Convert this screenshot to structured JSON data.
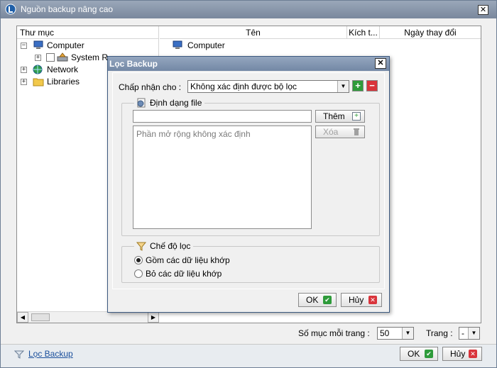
{
  "window": {
    "title": "Nguồn backup nâng cao",
    "close": "✕"
  },
  "columns": {
    "folder": "Thư mục",
    "name": "Tên",
    "size": "Kích t...",
    "modified": "Ngày thay đổi"
  },
  "tree": {
    "items": [
      {
        "label": "Computer",
        "expander": "−"
      },
      {
        "label": "System R",
        "expander": "+"
      },
      {
        "label": "Network",
        "expander": "+"
      },
      {
        "label": "Libraries",
        "expander": "+"
      }
    ]
  },
  "list": {
    "rows": [
      "Computer"
    ]
  },
  "status": {
    "per_page_label": "Số mục mỗi trang :",
    "per_page_value": "50",
    "page_label": "Trang :",
    "page_value": "-"
  },
  "footer": {
    "filter_link": "Lọc Backup",
    "ok": "OK",
    "cancel": "Hủy"
  },
  "dialog": {
    "title": "Lọc Backup",
    "close": "✕",
    "accept_label": "Chấp nhận cho :",
    "accept_value": "Không xác định được bộ lọc",
    "add": "+",
    "remove": "−",
    "format_group": "Định dạng file",
    "format_input": "",
    "add_button": "Thêm",
    "delete_button": "Xóa",
    "extension_placeholder": "Phần mở rộng không xác định",
    "mode_group": "Chế độ lọc",
    "mode_include": "Gồm các dữ liệu khớp",
    "mode_exclude": "Bỏ các dữ liệu khớp",
    "mode_selected": "include",
    "ok": "OK",
    "cancel": "Hủy"
  }
}
